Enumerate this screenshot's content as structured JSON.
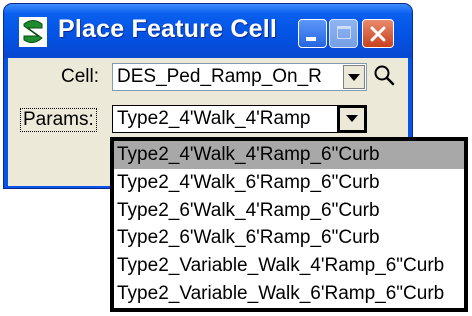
{
  "window": {
    "title": "Place Feature Cell",
    "icon": "app-cell-icon",
    "controls": [
      "minimize-icon",
      "maximize-icon",
      "close-icon"
    ]
  },
  "form": {
    "cell_label": "Cell:",
    "cell_value": "DES_Ped_Ramp_On_R",
    "params_label": "Params:",
    "params_value": "Type2_4'Walk_4'Ramp"
  },
  "dropdown": {
    "options": [
      "Type2_4'Walk_4'Ramp_6\"Curb",
      "Type2_4'Walk_6'Ramp_6\"Curb",
      "Type2_6'Walk_4'Ramp_6\"Curb",
      "Type2_6'Walk_6'Ramp_6\"Curb",
      "Type2_Variable_Walk_4'Ramp_6\"Curb",
      "Type2_Variable_Walk_6'Ramp_6\"Curb"
    ],
    "selected_index": 0
  },
  "colors": {
    "titlebar": "#0553e8",
    "client": "#ece9d8",
    "selection": "#a8a8a8"
  }
}
